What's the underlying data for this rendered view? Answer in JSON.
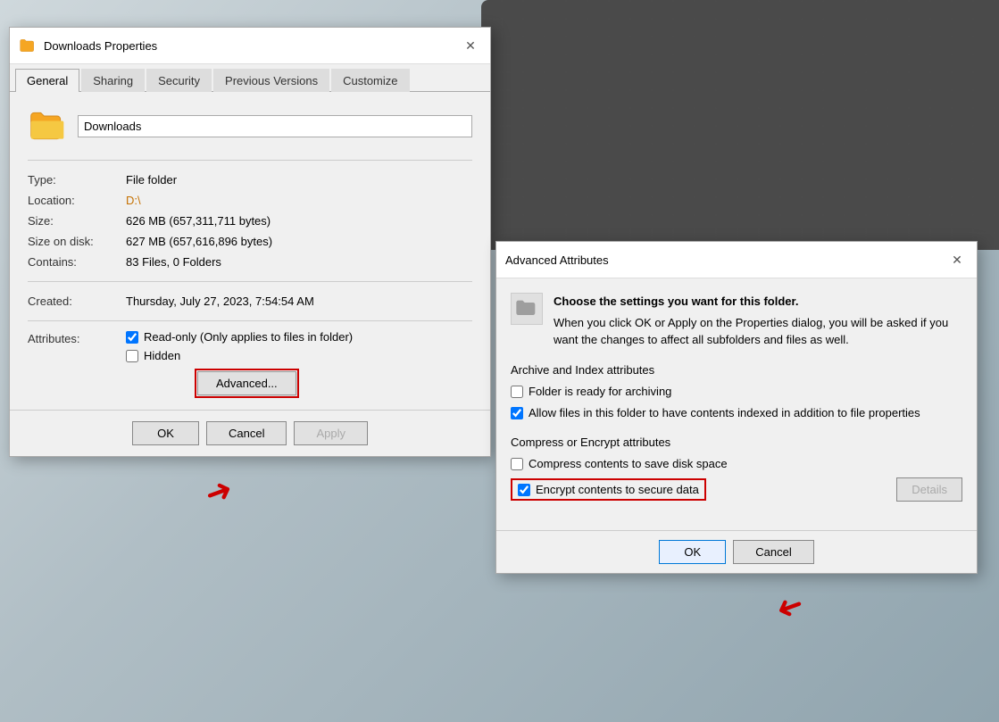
{
  "downloads_dialog": {
    "title": "Downloads Properties",
    "folder_name": "Downloads",
    "tabs": [
      {
        "label": "General",
        "active": true
      },
      {
        "label": "Sharing",
        "active": false
      },
      {
        "label": "Security",
        "active": false
      },
      {
        "label": "Previous Versions",
        "active": false
      },
      {
        "label": "Customize",
        "active": false
      }
    ],
    "props": {
      "type_label": "Type:",
      "type_value": "File folder",
      "location_label": "Location:",
      "location_value": "D:\\",
      "size_label": "Size:",
      "size_value": "626 MB (657,311,711 bytes)",
      "size_disk_label": "Size on disk:",
      "size_disk_value": "627 MB (657,616,896 bytes)",
      "contains_label": "Contains:",
      "contains_value": "83 Files, 0 Folders",
      "created_label": "Created:",
      "created_value": "Thursday, July 27, 2023, 7:54:54 AM"
    },
    "attributes": {
      "label": "Attributes:",
      "readonly_label": "Read-only (Only applies to files in folder)",
      "hidden_label": "Hidden",
      "advanced_button": "Advanced..."
    },
    "footer": {
      "ok": "OK",
      "cancel": "Cancel",
      "apply": "Apply"
    }
  },
  "advanced_dialog": {
    "title": "Advanced Attributes",
    "description_line1": "Choose the settings you want for this folder.",
    "description_line2": "When you click OK or Apply on the Properties dialog, you will be asked if you want the changes to affect all subfolders and files as well.",
    "archive_section": "Archive and Index attributes",
    "archive_check1": "Folder is ready for archiving",
    "archive_check1_checked": false,
    "archive_check2": "Allow files in this folder to have contents indexed in addition to file properties",
    "archive_check2_checked": true,
    "compress_section": "Compress or Encrypt attributes",
    "compress_check": "Compress contents to save disk space",
    "compress_checked": false,
    "encrypt_check": "Encrypt contents to secure data",
    "encrypt_checked": true,
    "details_button": "Details",
    "footer": {
      "ok": "OK",
      "cancel": "Cancel"
    }
  }
}
